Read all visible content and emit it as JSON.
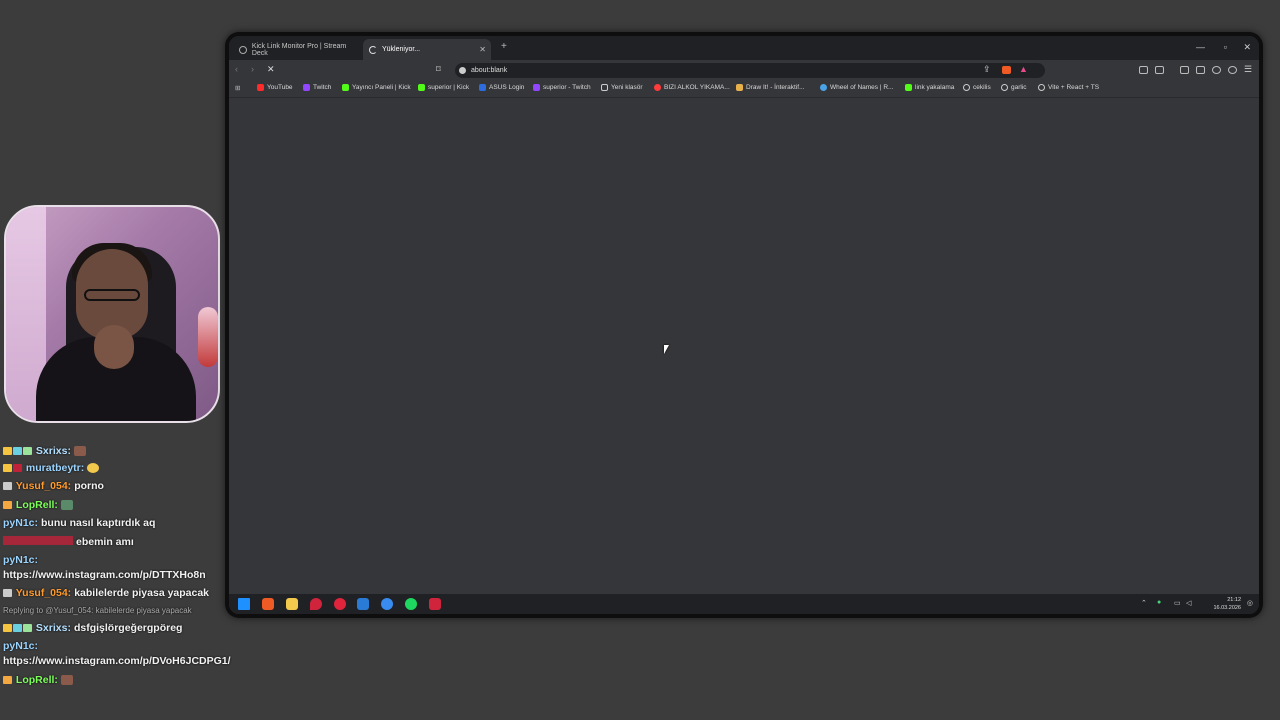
{
  "chat": [
    {
      "name": "Sxrixs:",
      "name_color": "#b3e0ff",
      "message": ""
    },
    {
      "name": "muratbeytr:",
      "name_color": "#9bd4ff",
      "message": ""
    },
    {
      "name": "Yusuf_054:",
      "name_color": "#ff9a2e",
      "message": "porno"
    },
    {
      "name": "LopRell:",
      "name_color": "#7dff5a",
      "message": ""
    },
    {
      "name": "pyN1c:",
      "name_color": "#9bd4ff",
      "message": "bunu nasıl kaptırdık aq"
    },
    {
      "name": "",
      "name_color": "#c0223a",
      "message": "ebemin amı"
    },
    {
      "name": "pyN1c:",
      "name_color": "#9bd4ff",
      "message": ""
    },
    {
      "name": "",
      "name_color": "#fff",
      "message": "https://www.instagram.com/p/DTTXHo8n"
    },
    {
      "name": "Yusuf_054:",
      "name_color": "#ff9a2e",
      "message": "kabilelerde piyasa yapacak"
    },
    {
      "name": "",
      "name_color": "#aaa",
      "message": "Replying to @Yusuf_054: kabilelerde piyasa yapacak"
    },
    {
      "name": "Sxrixs:",
      "name_color": "#b3e0ff",
      "message": "dsfgişlörgeğergpöreg"
    },
    {
      "name": "pyN1c:",
      "name_color": "#9bd4ff",
      "message": ""
    },
    {
      "name": "",
      "name_color": "#fff",
      "message": "https://www.instagram.com/p/DVoH6JCDPG1/"
    },
    {
      "name": "LopRell:",
      "name_color": "#7dff5a",
      "message": ""
    }
  ],
  "browser": {
    "tabs": [
      {
        "label": "Kick Link Monitor Pro | Stream Deck"
      },
      {
        "label": "Yükleniyor..."
      }
    ],
    "new_tab": "+",
    "url": "about:blank",
    "bookmarks": [
      {
        "label": "YouTube",
        "color": "#ff2a2a"
      },
      {
        "label": "Twitch",
        "color": "#9146ff"
      },
      {
        "label": "Yayıncı Paneli | Kick",
        "color": "#53fc18"
      },
      {
        "label": "superior | Kick",
        "color": "#53fc18"
      },
      {
        "label": "ASUS Login",
        "color": "#2d6cdf"
      },
      {
        "label": "superior - Twitch",
        "color": "#9146ff"
      },
      {
        "label": "Yeni klasör",
        "color": "#cccccc"
      },
      {
        "label": "BIZI ALKOL YIKAMA...",
        "color": "#ff3b3b"
      },
      {
        "label": "Draw It! - İnteraktif...",
        "color": "#e8b04a"
      },
      {
        "label": "Wheel of Names | R...",
        "color": "#4aa3e8"
      },
      {
        "label": "link yakalama",
        "color": "#53fc18"
      },
      {
        "label": "cekilis",
        "color": "#cccccc"
      },
      {
        "label": "garlic",
        "color": "#cccccc"
      },
      {
        "label": "Vite + React + TS",
        "color": "#cccccc"
      }
    ]
  },
  "taskbar": {
    "time": "21:12",
    "date": "16.03.2026",
    "apps": [
      "windows-start",
      "brave",
      "file-explorer",
      "app-red-pin",
      "app-red-circle",
      "steam",
      "app-blue",
      "spotify",
      "app-red-box"
    ]
  }
}
